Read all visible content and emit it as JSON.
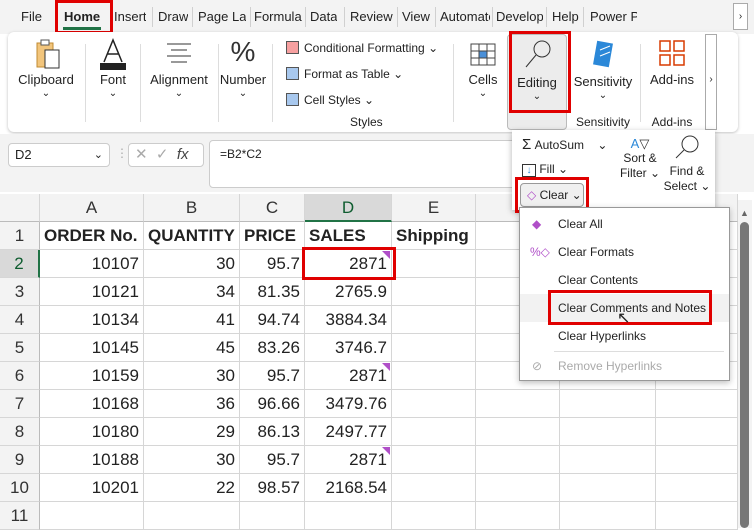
{
  "tabs": [
    "File",
    "Home",
    "Insert",
    "Draw",
    "Page Layout",
    "Formulas",
    "Data",
    "Review",
    "View",
    "Automate",
    "Developer",
    "Help",
    "Power Pivot"
  ],
  "ribbon": {
    "clipboard": "Clipboard",
    "font": "Font",
    "alignment": "Alignment",
    "number": "Number",
    "conditional_formatting": "Conditional Formatting",
    "format_as_table": "Format as Table",
    "cell_styles": "Cell Styles",
    "styles_group": "Styles",
    "cells": "Cells",
    "editing": "Editing",
    "sensitivity": "Sensitivity",
    "sensitivity_group": "Sensitivity",
    "addins": "Add-ins",
    "addins_group": "Add-ins"
  },
  "formula_bar": {
    "name_box": "D2",
    "fx": "fx",
    "formula": "=B2*C2"
  },
  "columns": [
    "A",
    "B",
    "C",
    "D",
    "E"
  ],
  "rows": [
    [
      "ORDER No.",
      "QUANTITY",
      "PRICE",
      "SALES",
      "Shipping"
    ],
    [
      "10107",
      "30",
      "95.7",
      "2871",
      ""
    ],
    [
      "10121",
      "34",
      "81.35",
      "2765.9",
      ""
    ],
    [
      "10134",
      "41",
      "94.74",
      "3884.34",
      ""
    ],
    [
      "10145",
      "45",
      "83.26",
      "3746.7",
      ""
    ],
    [
      "10159",
      "30",
      "95.7",
      "2871",
      ""
    ],
    [
      "10168",
      "36",
      "96.66",
      "3479.76",
      ""
    ],
    [
      "10180",
      "29",
      "86.13",
      "2497.77",
      ""
    ],
    [
      "10188",
      "30",
      "95.7",
      "2871",
      ""
    ],
    [
      "10201",
      "22",
      "98.57",
      "2168.54",
      ""
    ],
    [
      "",
      "",
      "",
      "",
      ""
    ]
  ],
  "notes_rows": [
    2,
    6,
    9
  ],
  "editing_panel": {
    "autosum": "AutoSum",
    "fill": "Fill",
    "clear": "Clear",
    "sort_filter_1": "Sort &",
    "sort_filter_2": "Filter",
    "find_select_1": "Find &",
    "find_select_2": "Select"
  },
  "clear_menu": [
    "Clear All",
    "Clear Formats",
    "Clear Contents",
    "Clear Comments and Notes",
    "Clear Hyperlinks",
    "Remove Hyperlinks"
  ],
  "colors": {
    "highlight": "#e00000",
    "note": "#b04fc8",
    "selected": "#217346"
  }
}
